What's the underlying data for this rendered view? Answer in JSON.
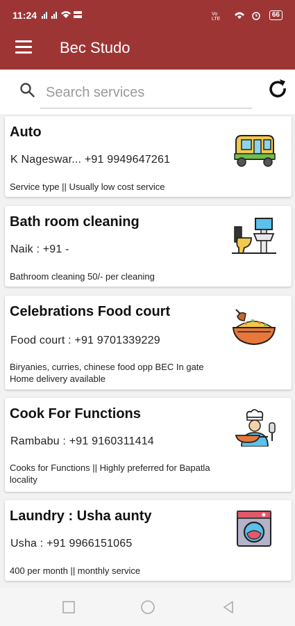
{
  "status": {
    "time": "11:24",
    "battery": "66"
  },
  "app": {
    "title": "Bec Studo"
  },
  "search": {
    "placeholder": "Search services"
  },
  "cards": [
    {
      "title": "Auto",
      "contact": "K Nageswar... +91 9949647261",
      "desc": "Service type || Usually low cost service",
      "icon": "auto-rickshaw-icon"
    },
    {
      "title": "Bath room cleaning",
      "contact": "Naik : +91 -",
      "desc": "Bathroom cleaning 50/- per cleaning",
      "icon": "bathroom-icon"
    },
    {
      "title": "Celebrations Food court",
      "contact": "Food court : +91 9701339229",
      "desc": "Biryanies, curries, chinese food opp BEC In gate Home delivery available",
      "icon": "biryani-bowl-icon"
    },
    {
      "title": "Cook For Functions",
      "contact": "Rambabu  : +91 9160311414",
      "desc": "Cooks for Functions || Highly preferred for Bapatla locality",
      "icon": "chef-icon"
    },
    {
      "title": "Laundry : Usha aunty",
      "contact": "Usha  : +91 9966151065",
      "desc": "400 per month || monthly service",
      "icon": "washing-machine-icon"
    }
  ],
  "colors": {
    "primary": "#9e3535",
    "background": "#f2f2f2",
    "card": "#ffffff"
  }
}
